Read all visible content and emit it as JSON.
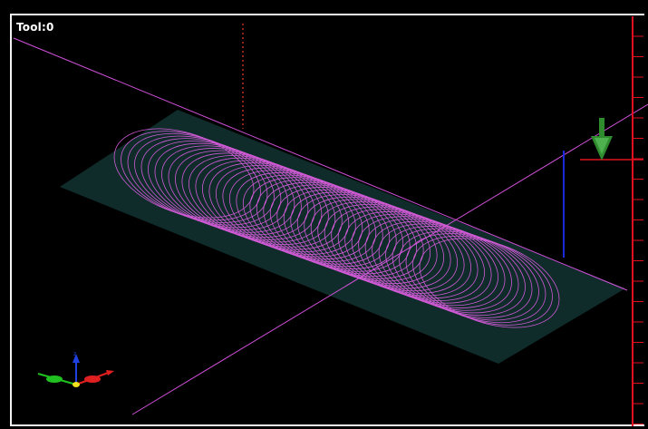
{
  "viewer": {
    "tool_label": "Tool:0"
  },
  "colors": {
    "background": "#000000",
    "frame": "#f2f2f2",
    "stock": "#0f2b2a",
    "toolpath": "#d15bd6",
    "axis_line": "#d050d8",
    "ruler": "#e01020",
    "tool_arrow": "#2e8b2e",
    "tool_marker": "#1a2ad8",
    "z_axis_marker": "#c03020",
    "triad_x": "#e02020",
    "triad_y": "#20c020",
    "triad_z": "#2040e0",
    "triad_origin": "#f0e020"
  },
  "icons": {
    "tool_arrow": "down-arrow-icon",
    "triad": "xyz-axis-triad-icon"
  }
}
